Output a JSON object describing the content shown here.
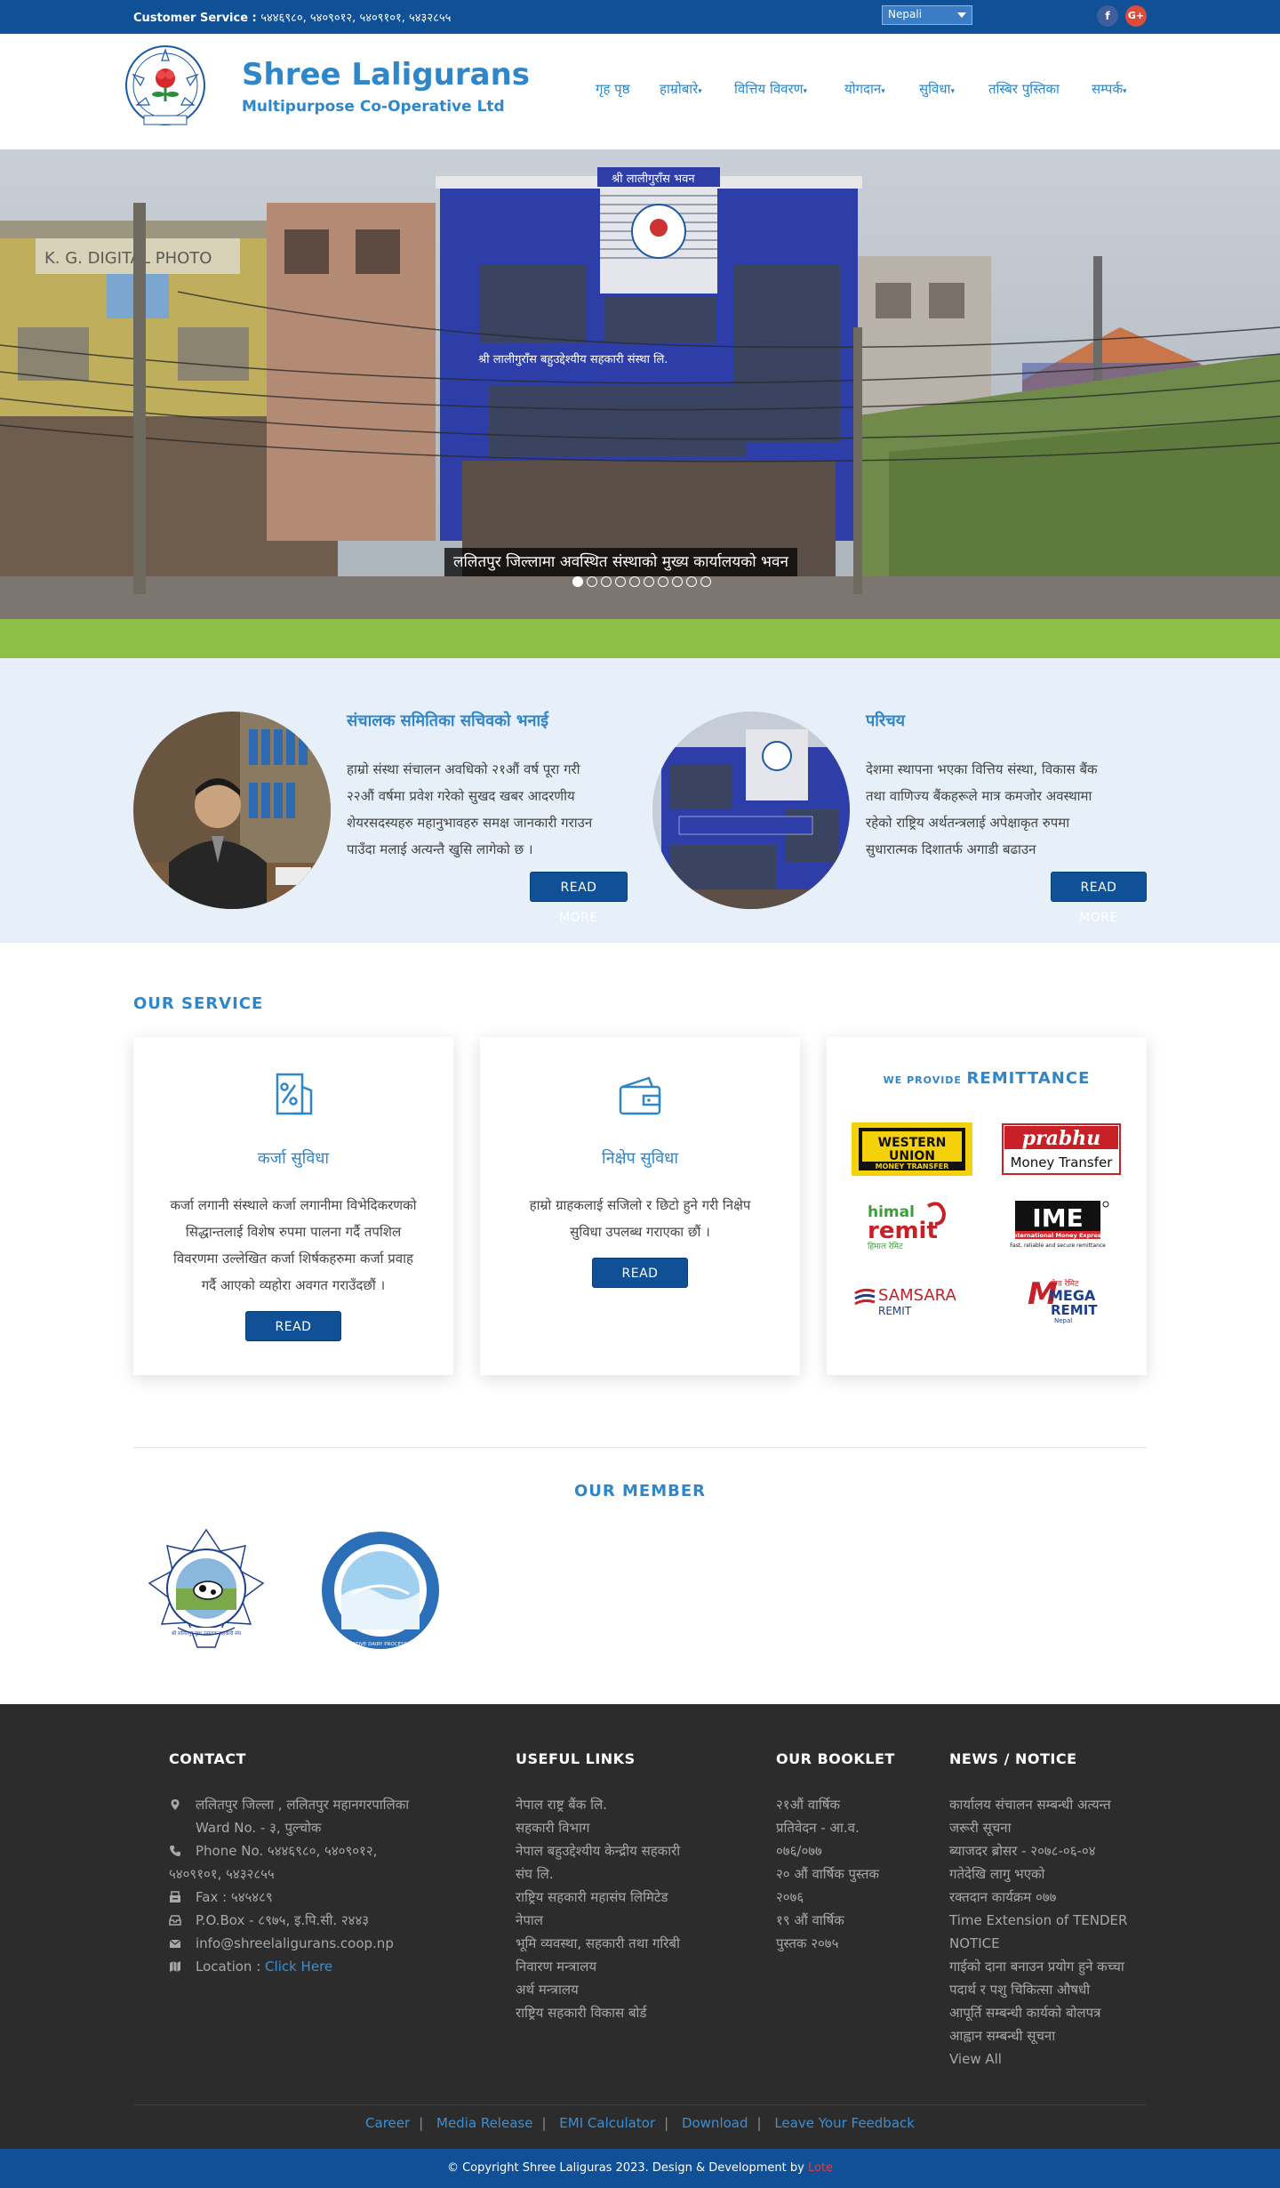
{
  "topbar": {
    "cs_label": "Customer Service :",
    "cs_phones": "५४४६९८०, ५४०९०१२, ५४०९१०१, ५४३२८५५",
    "language": "Nepali",
    "facebook_glyph": "f",
    "gplus_glyph": "G+"
  },
  "header": {
    "title": "Shree Laligurans",
    "subtitle": "Multipurpose Co-Operative Ltd"
  },
  "nav": {
    "items": [
      {
        "label": "गृह पृष्ठ",
        "caret": ""
      },
      {
        "label": "हाम्रोबारे",
        "caret": "▾"
      },
      {
        "label": "वित्तिय विवरण",
        "caret": "▾"
      },
      {
        "label": "योगदान",
        "caret": "▾"
      },
      {
        "label": "सुविधा",
        "caret": "▾"
      },
      {
        "label": "तस्बिर पुस्तिका",
        "caret": ""
      },
      {
        "label": "सम्पर्क",
        "caret": "▾"
      }
    ]
  },
  "hero": {
    "building_sign_top": "श्री लालीगुराँस भवन",
    "building_sign_main": "श्री लालीगुराँस बहुउद्देश्यीय सहकारी संस्था लि.",
    "shop_sign": "K. G. DIGITAL PHOTO",
    "caption": "ललितपुर जिल्लामा अवस्थित संस्थाको मुख्य कार्यालयको भवन",
    "slides": 10,
    "active_slide": 1
  },
  "intro": {
    "chairman": {
      "title": "संचालक समितिका सचिवको भनाई",
      "text_lines": [
        "हाम्रो संस्था संचालन अवधिको २१औं वर्ष पूरा गरी",
        "२२औं वर्षमा प्रवेश गरेको सुखद खबर आदरणीय",
        "शेयरसदस्यहरु महानुभावहरु समक्ष जानकारी गराउन",
        "पाउँदा मलाई अत्यन्तै खुसि लागेको छ ।"
      ],
      "button": "READ MORE"
    },
    "about": {
      "title": "परिचय",
      "text_lines": [
        "देशमा स्थापना भएका वित्तिय संस्था, विकास बैंक",
        "तथा वाणिज्य बैंकहरूले मात्र कमजोर अवस्थामा",
        "रहेको राष्ट्रिय अर्थतन्त्रलाई अपेक्षाकृत रुपमा",
        "सुधारात्मक दिशातर्फ अगाडी बढाउन"
      ],
      "button": "READ MORE"
    }
  },
  "service": {
    "section_title": "OUR SERVICE",
    "loan": {
      "icon": "loan-percent-icon",
      "title": "कर्जा सुविधा",
      "text_lines": [
        "कर्जा लगानी संस्थाले कर्जा लगानीमा विभेदिकरणको",
        "सिद्धान्तलाई विशेष रुपमा पालना गर्दै तपशिल",
        "विवरणमा उल्लेखित कर्जा शिर्षकहरुमा कर्जा प्रवाह",
        "गर्दै आएको व्यहोरा अवगत गराउँदछौं ।"
      ],
      "button": "READ MORE"
    },
    "deposit": {
      "icon": "wallet-icon",
      "title": "निक्षेप सुविधा",
      "text_lines": [
        "हाम्रो ग्राहकलाई सजिलो र छिटो हुने गरी निक्षेप",
        "सुविधा उपलब्ध गराएका छौं ।"
      ],
      "button": "READ MORE"
    },
    "remittance": {
      "prefix": "WE PROVIDE",
      "title": "REMITTANCE",
      "western_union": [
        "WESTERN",
        "UNION",
        "MONEY TRANSFER"
      ],
      "prabhu": [
        "prabhu",
        "Money Transfer"
      ],
      "himal": [
        "himal",
        "remit",
        "हिमाल रेमिट"
      ],
      "ime": [
        "IME",
        "International Money Express",
        "Fast, reliable and secure remittance"
      ],
      "samsara": [
        "SAMSARA",
        "REMIT"
      ],
      "mega": [
        "मेगा रेमिट",
        "MEGA",
        "REMIT",
        "Nepal"
      ]
    }
  },
  "members": {
    "section_title": "OUR MEMBER",
    "logo1_text": "श्री ललितपुर दुग्ध उत्पादक सहकारी संघ",
    "logo2_text": "SLM CO-OPERATIVE DAIRY PROCESSING INDUSTRY"
  },
  "footer": {
    "contact": {
      "title": "CONTACT",
      "address_lines": [
        "ललितपुर जिल्ला , ललितपुर महानगरपालिका",
        "Ward No. - ३, पुल्चोक"
      ],
      "phone_lines": [
        "Phone No. ५४४६९८०, ५४०९०१२,",
        "५४०९१०१, ५४३२८५५"
      ],
      "fax": "Fax : ५४५४८९",
      "pobox": "P.O.Box - ८९७५, इ.पि.सी. २४४३",
      "email": "info@shreelaligurans.coop.np",
      "location_label": "Location :",
      "location_link": "Click Here"
    },
    "useful_links": {
      "title": "USEFUL LINKS",
      "lines": [
        "नेपाल राष्ट्र बैंक लि.",
        "सहकारी विभाग",
        "नेपाल बहुउद्देश्यीय केन्द्रीय सहकारी",
        "संघ लि.",
        "राष्ट्रिय सहकारी महासंघ लिमिटेड",
        "नेपाल",
        "भूमि व्यवस्था, सहकारी तथा गरिबी",
        "निवारण मन्त्रालय",
        "अर्थ मन्त्रालय",
        "राष्ट्रिय सहकारी विकास बोर्ड"
      ]
    },
    "booklet": {
      "title": "OUR BOOKLET",
      "lines": [
        "२१औं वार्षिक",
        "प्रतिवेदन - आ.व.",
        "०७६/०७७",
        "२० औं वार्षिक पुस्तक",
        "२०७६",
        "१९ औं वार्षिक",
        "पुस्तक २०७५"
      ]
    },
    "news": {
      "title": "NEWS / NOTICE",
      "lines": [
        "कार्यालय संचालन सम्बन्धी अत्यन्त",
        "जरूरी सूचना",
        "ब्याजदर ब्रोसर - २०७८-०६-०४",
        "गतेदेखि लागु भएको",
        "रक्तदान कार्यक्रम ०७७",
        "Time Extension of TENDER",
        "NOTICE",
        "गाईको दाना बनाउन प्रयोग हुने कच्चा",
        "पदार्थ र पशु चिकित्सा औषधी",
        "आपूर्ति सम्बन्धी कार्यको बोलपत्र",
        "आह्वान सम्बन्धी सूचना",
        "View All"
      ]
    },
    "bottom_links": [
      "Career",
      "Media Release",
      "EMI Calculator",
      "Download",
      "Leave Your Feedback"
    ],
    "copyright": "© Copyright Shree Laliguras 2023. Design & Development by",
    "developer": "Lote"
  }
}
